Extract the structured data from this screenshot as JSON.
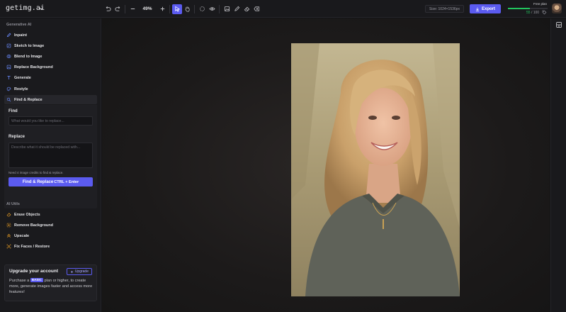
{
  "app": {
    "logo": "getimg.ai"
  },
  "toolbar": {
    "zoom": "49%",
    "size": "Size: 1024×1536px",
    "export_label": "Export"
  },
  "plan": {
    "label": "Free plan",
    "used": "55",
    "total": "/ 100",
    "progress_fraction": 0.55,
    "accent": "#22c55e"
  },
  "sidebar": {
    "generative_title": "Generative AI",
    "items": [
      {
        "label": "Inpaint",
        "icon": "pen-icon"
      },
      {
        "label": "Sketch to Image",
        "icon": "sketch-icon"
      },
      {
        "label": "Blend to Image",
        "icon": "blend-icon"
      },
      {
        "label": "Replace Background",
        "icon": "image-icon"
      },
      {
        "label": "Generate",
        "icon": "text-icon"
      },
      {
        "label": "Restyle",
        "icon": "palette-icon"
      },
      {
        "label": "Find & Replace",
        "icon": "search-replace-icon"
      }
    ],
    "panel": {
      "find_label": "Find",
      "find_placeholder": "What would you like to replace...",
      "replace_label": "Replace",
      "replace_placeholder": "Describe what it should be replaced with...",
      "credits_note": "Need 4 image credits to find & replace.",
      "button_label": "Find & Replace",
      "shortcut": "CTRL + Enter"
    },
    "utils_title": "AI Utils",
    "utils": [
      {
        "label": "Erase Objects",
        "icon": "eraser-icon"
      },
      {
        "label": "Remove Background",
        "icon": "remove-bg-icon"
      },
      {
        "label": "Upscale",
        "icon": "upscale-icon"
      },
      {
        "label": "Fix Faces / Restore",
        "icon": "face-icon"
      }
    ],
    "upgrade": {
      "title": "Upgrade your account",
      "button": "Upgrade",
      "text_before": "Purchase a",
      "badge": "BASIC",
      "text_after": "plan or higher, to create more, generate images faster and access more features!"
    }
  },
  "colors": {
    "brand": "#5b5bf0",
    "bg": "#141416",
    "sidebar": "#1a1a1d"
  }
}
